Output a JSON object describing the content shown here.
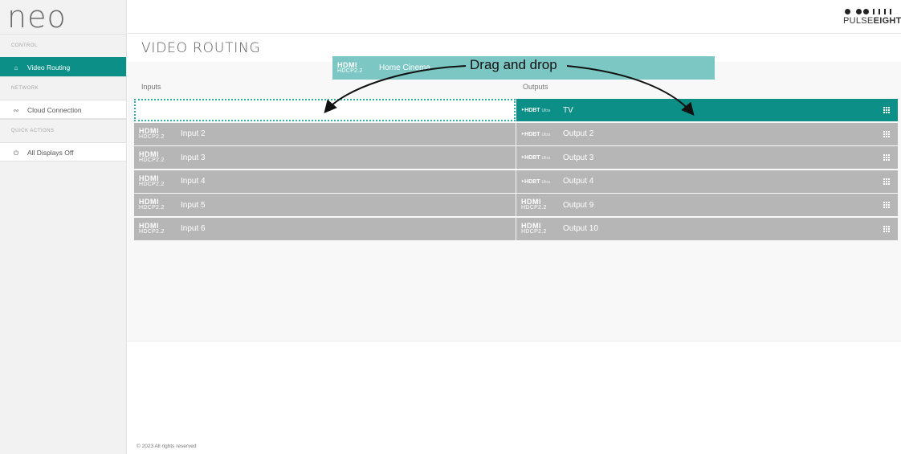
{
  "app": {
    "logo": "neo"
  },
  "brand": {
    "line1": "PULSE",
    "line2": "EIGHT"
  },
  "sidebar": {
    "sections": [
      {
        "title": "CONTROL",
        "items": [
          {
            "label": "Video Routing",
            "icon": "home-icon",
            "active": true
          }
        ]
      },
      {
        "title": "NETWORK",
        "items": [
          {
            "label": "Cloud Connection",
            "icon": "wifi-icon",
            "active": false
          }
        ]
      },
      {
        "title": "QUICK ACTIONS",
        "items": [
          {
            "label": "All Displays Off",
            "icon": "power-icon",
            "active": false
          }
        ]
      }
    ]
  },
  "page": {
    "title": "VIDEO ROUTING"
  },
  "inputs": {
    "header": "Inputs",
    "items": [
      {
        "label": "",
        "logo": "hdmi",
        "placeholder": true
      },
      {
        "label": "Input 2",
        "logo": "hdmi"
      },
      {
        "label": "Input 3",
        "logo": "hdmi"
      },
      {
        "label": "Input 4",
        "logo": "hdmi"
      },
      {
        "label": "Input 5",
        "logo": "hdmi"
      },
      {
        "label": "Input 6",
        "logo": "hdmi"
      }
    ]
  },
  "outputs": {
    "header": "Outputs",
    "items": [
      {
        "label": "TV",
        "logo": "hdbt",
        "selected": true
      },
      {
        "label": "Output 2",
        "logo": "hdbt"
      },
      {
        "label": "Output 3",
        "logo": "hdbt"
      },
      {
        "label": "Output 4",
        "logo": "hdbt"
      },
      {
        "label": "Output 9",
        "logo": "hdmi"
      },
      {
        "label": "Output 10",
        "logo": "hdmi"
      }
    ]
  },
  "dragged": {
    "label": "Home Cinema",
    "logo": "hdmi"
  },
  "annotation": {
    "text": "Drag and drop"
  },
  "logos": {
    "hdmi_top": "HDMI",
    "hdmi_bottom": "HDCP2.2",
    "hdbt_main": "HDBT",
    "hdbt_sub": "Ultra"
  },
  "footer": {
    "copyright": "© 2023 All rights reserved"
  },
  "colors": {
    "accent": "#0b8f86",
    "row_bg": "#b6b6b6",
    "drag_bg": "#7cc7c3",
    "drop_border": "#2cb0a8"
  }
}
